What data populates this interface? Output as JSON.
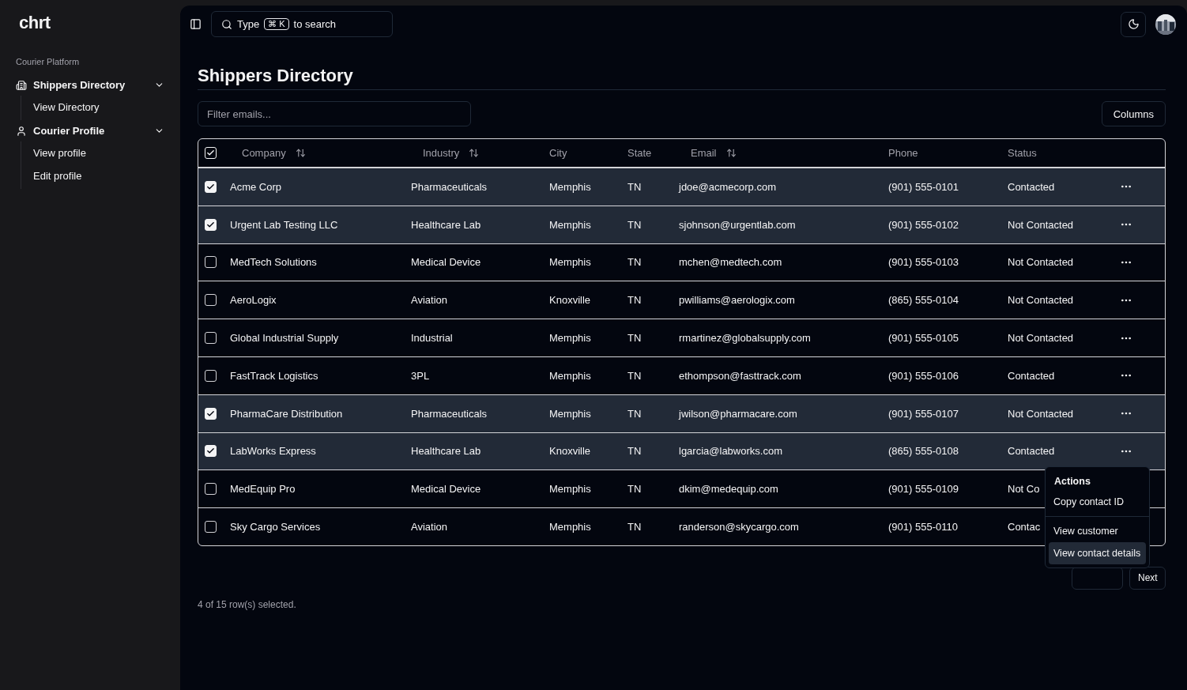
{
  "sidebar": {
    "logo": "chrt",
    "section": "Courier Platform",
    "groups": [
      {
        "label": "Shippers Directory",
        "expanded": true,
        "children": [
          {
            "label": "View Directory"
          }
        ]
      },
      {
        "label": "Courier Profile",
        "expanded": true,
        "children": [
          {
            "label": "View profile"
          },
          {
            "label": "Edit profile"
          }
        ]
      }
    ]
  },
  "topbar": {
    "search": {
      "before": "Type",
      "key": "⌘ K",
      "after": "to search"
    }
  },
  "page": {
    "title": "Shippers Directory",
    "filter": {
      "placeholder": "Filter emails..."
    },
    "columns_button": "Columns"
  },
  "table": {
    "all_checked": true,
    "columns": [
      {
        "label": "Company",
        "kind": "sortable"
      },
      {
        "label": "Industry",
        "kind": "sortable"
      },
      {
        "label": "City",
        "kind": "plain"
      },
      {
        "label": "State",
        "kind": "plain"
      },
      {
        "label": "Email",
        "kind": "sortable"
      },
      {
        "label": "Phone",
        "kind": "plain"
      },
      {
        "label": "Status",
        "kind": "plain"
      }
    ],
    "rows": [
      {
        "selected": true,
        "cells": [
          "Acme Corp",
          "Pharmaceuticals",
          "Memphis",
          "TN",
          "jdoe@acmecorp.com",
          "(901) 555-0101",
          "Contacted"
        ]
      },
      {
        "selected": true,
        "cells": [
          "Urgent Lab Testing LLC",
          "Healthcare Lab",
          "Memphis",
          "TN",
          "sjohnson@urgentlab.com",
          "(901) 555-0102",
          "Not Contacted"
        ]
      },
      {
        "selected": false,
        "cells": [
          "MedTech Solutions",
          "Medical Device",
          "Memphis",
          "TN",
          "mchen@medtech.com",
          "(901) 555-0103",
          "Not Contacted"
        ]
      },
      {
        "selected": false,
        "cells": [
          "AeroLogix",
          "Aviation",
          "Knoxville",
          "TN",
          "pwilliams@aerologix.com",
          "(865) 555-0104",
          "Not Contacted"
        ]
      },
      {
        "selected": false,
        "cells": [
          "Global Industrial Supply",
          "Industrial",
          "Memphis",
          "TN",
          "rmartinez@globalsupply.com",
          "(901) 555-0105",
          "Not Contacted"
        ]
      },
      {
        "selected": false,
        "cells": [
          "FastTrack Logistics",
          "3PL",
          "Memphis",
          "TN",
          "ethompson@fasttrack.com",
          "(901) 555-0106",
          "Contacted"
        ]
      },
      {
        "selected": true,
        "cells": [
          "PharmaCare Distribution",
          "Pharmaceuticals",
          "Memphis",
          "TN",
          "jwilson@pharmacare.com",
          "(901) 555-0107",
          "Not Contacted"
        ]
      },
      {
        "selected": true,
        "cells": [
          "LabWorks Express",
          "Healthcare Lab",
          "Knoxville",
          "TN",
          "lgarcia@labworks.com",
          "(865) 555-0108",
          "Contacted"
        ]
      },
      {
        "selected": false,
        "menu_covered": true,
        "cells": [
          "MedEquip Pro",
          "Medical Device",
          "Memphis",
          "TN",
          "dkim@medequip.com",
          "(901) 555-0109",
          "Not Co"
        ]
      },
      {
        "selected": false,
        "menu_covered": true,
        "cells": [
          "Sky Cargo Services",
          "Aviation",
          "Memphis",
          "TN",
          "randerson@skycargo.com",
          "(901) 555-0110",
          "Contac"
        ]
      }
    ]
  },
  "pagination": {
    "next": "Next",
    "selection_info": "4 of 15 row(s) selected."
  },
  "menu": {
    "title": "Actions",
    "items": [
      {
        "label": "Copy contact ID",
        "selected": false,
        "divider_after": true
      },
      {
        "label": "View customer",
        "selected": false,
        "divider_after": false
      },
      {
        "label": "View contact details",
        "selected": true,
        "divider_after": false
      }
    ]
  }
}
